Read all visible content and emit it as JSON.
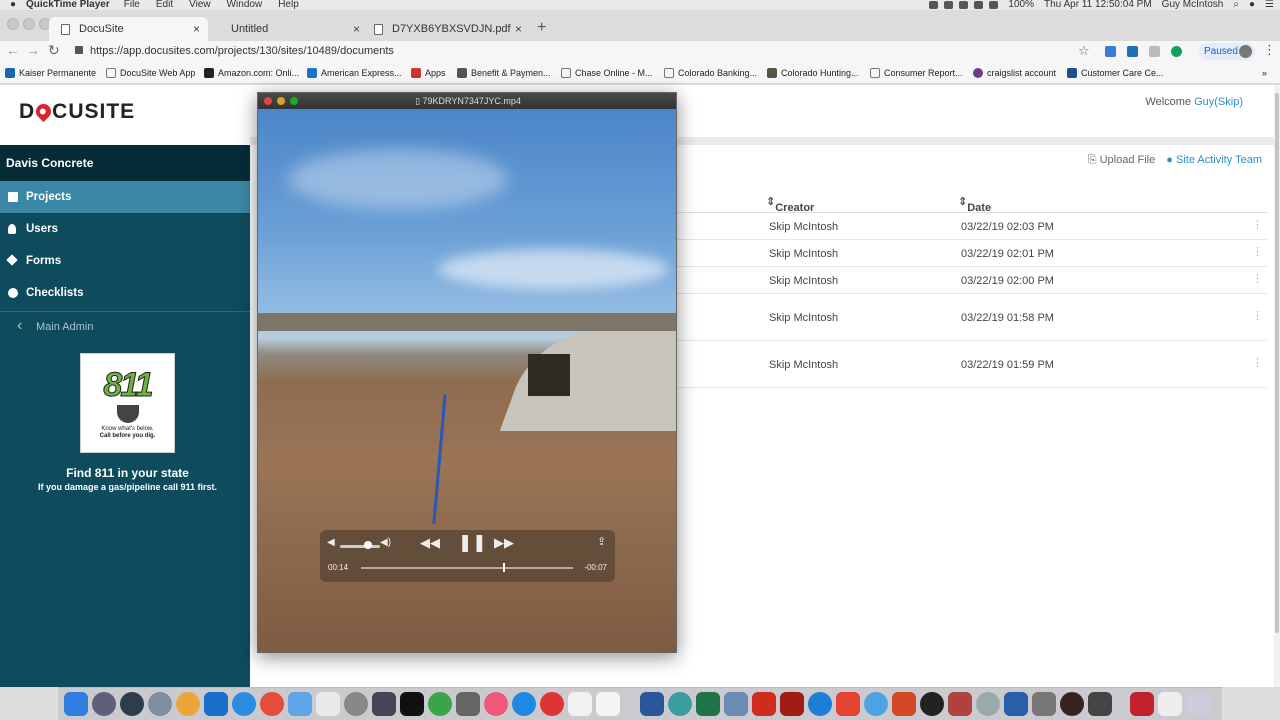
{
  "menubar": {
    "app": "QuickTime Player",
    "menus": [
      "File",
      "Edit",
      "View",
      "Window",
      "Help"
    ],
    "battery": "100%",
    "clock": "Thu Apr 11  12:50:04 PM",
    "user": "Guy McIntosh"
  },
  "tabs": [
    {
      "label": "DocuSite",
      "active": true
    },
    {
      "label": "Untitled",
      "active": false
    },
    {
      "label": "D7YXB6YBXSVDJN.pdf",
      "active": false
    }
  ],
  "toolbar": {
    "url": "https://app.docusites.com/projects/130/sites/10489/documents",
    "profile_status": "Paused"
  },
  "bookmarks": [
    "Kaiser Permanente",
    "DocuSite Web App",
    "Amazon.com: Onli...",
    "American Express...",
    "Apps",
    "Benefit & Paymen...",
    "Chase Online - M...",
    "Colorado Banking...",
    "Colorado Hunting...",
    "Consumer Report...",
    "craigslist account",
    "Customer Care Ce..."
  ],
  "page": {
    "logo": "DOCUSITE",
    "welcome": "Welcome ",
    "welcome_user": "Guy(Skip)",
    "company": "Davis Concrete",
    "sidebar": [
      "Projects",
      "Users",
      "Forms",
      "Checklists"
    ],
    "main_admin": "Main Admin",
    "ad": {
      "number": "811",
      "tagline_1": "Know what's below.",
      "tagline_2": "Call before you dig.",
      "title": "Find 811 in your state",
      "subtitle": "If you damage a gas/pipeline call 911 first."
    },
    "actions": {
      "upload": "Upload File",
      "team": "Site Activity Team"
    },
    "table": {
      "headers": {
        "creator": "Creator",
        "date": "Date"
      },
      "rows": [
        {
          "creator": "Skip McIntosh",
          "date": "03/22/19 02:03 PM"
        },
        {
          "creator": "Skip McIntosh",
          "date": "03/22/19 02:01 PM"
        },
        {
          "creator": "Skip McIntosh",
          "date": "03/22/19 02:00 PM"
        },
        {
          "creator": "Skip McIntosh",
          "date": "03/22/19 01:58 PM"
        },
        {
          "creator": "Skip McIntosh",
          "date": "03/22/19 01:59 PM"
        }
      ]
    }
  },
  "player": {
    "title": "79KDRYN7347JYC.mp4",
    "elapsed": "00:14",
    "remaining": "-00:07",
    "progress": 0.67,
    "volume": 0.7
  },
  "colors": {
    "brand_teal": "#0e4b5c",
    "active_blue": "#3b88a6",
    "link_blue": "#2a8fc7",
    "logo_red": "#d9232e"
  }
}
